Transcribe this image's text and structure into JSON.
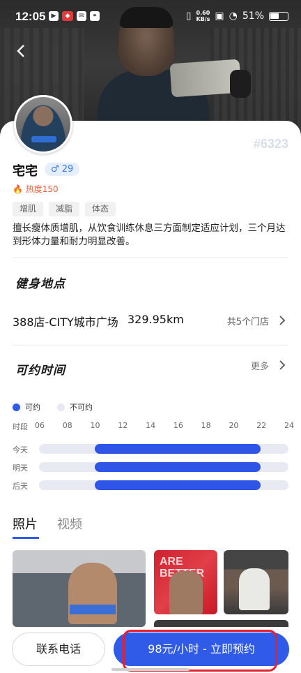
{
  "status_bar": {
    "time": "12:05",
    "network_speed": "0.60\nKB/s",
    "battery": "51%",
    "left_icons": [
      "play-icon",
      "app-icon",
      "message-icon",
      "link-icon"
    ]
  },
  "coach": {
    "name": "宅宅",
    "gender_symbol": "♂",
    "age": "29",
    "gender_label": "♂ 29",
    "number": "#6323",
    "heat": "热度150",
    "tags": [
      "增肌",
      "减脂",
      "体态"
    ],
    "description": "擅长瘦体质增肌，从饮食训练休息三方面制定适应计划，三个月达到形体力量和耐力明显改善。"
  },
  "location": {
    "section_title": "健身地点",
    "store_name": "388店-CITY城市广场",
    "distance": "329.95km",
    "store_count": "共5个门店"
  },
  "schedule": {
    "section_title": "可约时间",
    "more_label": "更多",
    "legend_available": "可约",
    "legend_unavailable": "不可约",
    "axis_label": "时段",
    "hours": [
      "06",
      "08",
      "10",
      "12",
      "14",
      "16",
      "18",
      "20",
      "22",
      "24"
    ],
    "days": [
      {
        "label": "今天",
        "start": 10,
        "end": 22
      },
      {
        "label": "明天",
        "start": 10,
        "end": 22
      },
      {
        "label": "后天",
        "start": 10,
        "end": 22
      }
    ],
    "colors": {
      "available": "#2f55e6",
      "unavailable": "#e8eaf3"
    }
  },
  "media_tabs": {
    "photos": "照片",
    "videos": "视频"
  },
  "actions": {
    "call": "联系电话",
    "book": "98元/小时 - 立即预约"
  },
  "accent_color": "#2f5be8"
}
